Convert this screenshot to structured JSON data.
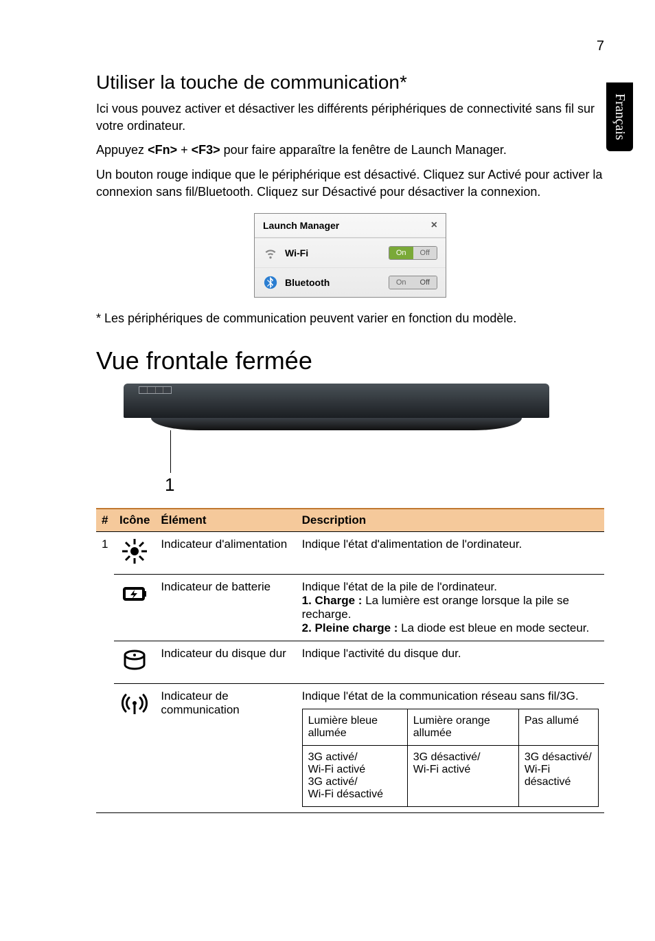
{
  "page_number": "7",
  "lang_tab": "Français",
  "section1_title": "Utiliser la touche de communication*",
  "section1_p1": "Ici vous pouvez activer et désactiver les différents périphériques de connectivité sans fil sur votre ordinateur.",
  "section1_p2_pre": "Appuyez ",
  "section1_p2_k1": "<Fn>",
  "section1_p2_mid": " + ",
  "section1_p2_k2": "<F3>",
  "section1_p2_post": " pour faire apparaître la fenêtre de Launch Manager.",
  "section1_p3": "Un bouton rouge indique que le périphérique est désactivé. Cliquez sur Activé pour activer la connexion sans fil/Bluetooth. Cliquez sur Désactivé pour désactiver la connexion.",
  "launch": {
    "title": "Launch Manager",
    "close": "×",
    "rows": [
      {
        "label": "Wi-Fi",
        "on": "On",
        "off": "Off",
        "active": "on"
      },
      {
        "label": "Bluetooth",
        "on": "On",
        "off": "Off",
        "active": "off"
      }
    ]
  },
  "section1_note": "* Les périphériques de communication peuvent varier en fonction du modèle.",
  "section2_title": "Vue frontale fermée",
  "callout_1": "1",
  "table": {
    "headers": {
      "num": "#",
      "icon": "Icône",
      "element": "Élément",
      "description": "Description"
    },
    "rows": [
      {
        "num": "1",
        "element": "Indicateur d'alimentation",
        "description": "Indique l'état d'alimentation de l'ordinateur."
      },
      {
        "element": "Indicateur de batterie",
        "desc_line1": "Indique l'état de la pile de l'ordinateur.",
        "desc_line2a": "1. Charge : ",
        "desc_line2b": "La lumière est orange lorsque la pile se recharge.",
        "desc_line3a": "2. Pleine charge : ",
        "desc_line3b": "La diode est bleue en mode secteur."
      },
      {
        "element": "Indicateur du disque dur",
        "description": "Indique l'activité du disque dur."
      },
      {
        "element": "Indicateur de communication",
        "description": "Indique l'état de la communication réseau sans fil/3G.",
        "inner": {
          "h1": "Lumière bleue allumée",
          "h2": "Lumière orange allumée",
          "h3": "Pas allumé",
          "c1": "3G activé/\nWi-Fi activé\n3G activé/\nWi-Fi désactivé",
          "c2": "3G désactivé/\nWi-Fi activé",
          "c3": "3G désactivé/\nWi-Fi désactivé"
        }
      }
    ]
  }
}
